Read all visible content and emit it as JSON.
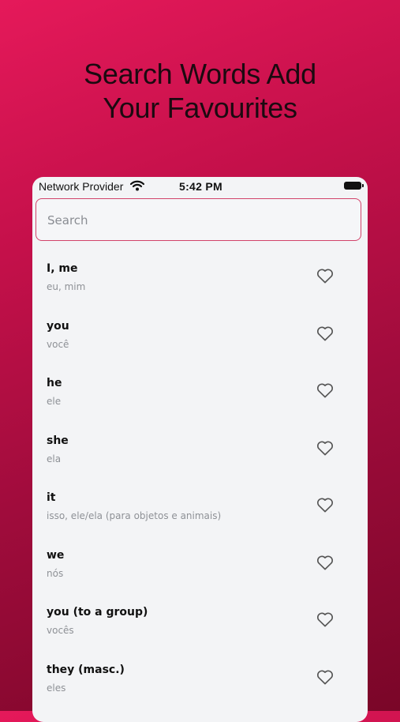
{
  "headline": {
    "line1": "Search Words Add",
    "line2": "Your Favourites"
  },
  "status_bar": {
    "carrier": "Network Provider",
    "time": "5:42 PM"
  },
  "search": {
    "placeholder": "Search",
    "value": ""
  },
  "words": [
    {
      "word": "I, me",
      "translation": "eu, mim",
      "favourite": false
    },
    {
      "word": "you",
      "translation": "você",
      "favourite": false
    },
    {
      "word": "he",
      "translation": "ele",
      "favourite": false
    },
    {
      "word": "she",
      "translation": "ela",
      "favourite": false
    },
    {
      "word": "it",
      "translation": "isso, ele/ela (para objetos e animais)",
      "favourite": false
    },
    {
      "word": "we",
      "translation": "nós",
      "favourite": false
    },
    {
      "word": "you (to a group)",
      "translation": "vocês",
      "favourite": false
    },
    {
      "word": "they (masc.)",
      "translation": "eles",
      "favourite": false
    }
  ],
  "colors": {
    "brand_gradient_start": "#e5195a",
    "brand_gradient_end": "#7a0628",
    "search_border": "#d2436a"
  },
  "icons": {
    "favourite": "heart-outline-icon",
    "wifi": "wifi-icon",
    "battery": "battery-icon"
  }
}
